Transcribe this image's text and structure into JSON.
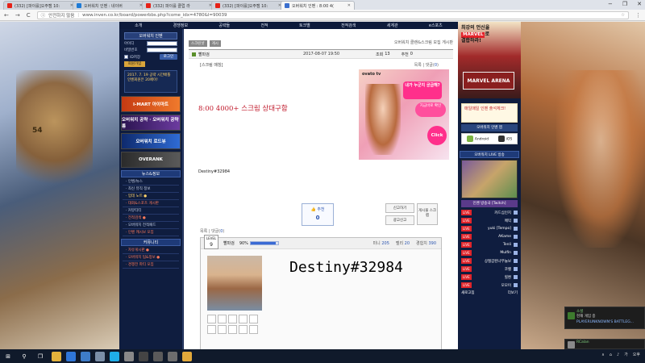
{
  "browser": {
    "tabs": [
      {
        "label": "(332) [파이를]오주캠 10:",
        "color": "#e62117",
        "active": false
      },
      {
        "label": "오버워치 인벤 : 네이버",
        "color": "#1e7bd6",
        "active": false
      },
      {
        "label": "(332) 파이를 클럽 라",
        "color": "#e62117",
        "active": false
      },
      {
        "label": "(332) [파이를]오주캠 10:",
        "color": "#e62117",
        "active": false
      },
      {
        "label": "오버워치 인벤 : 8:00 4(",
        "color": "#3b6fce",
        "active": true
      }
    ],
    "url_secure_label": "안전하지 않음",
    "url": "www.inven.co.kr/board/powerbbs.php?come_idx=4780&l=90039",
    "nav_back": "←",
    "nav_forward": "→",
    "nav_reload": "C",
    "win_min": "−",
    "win_max": "❐",
    "win_close": "✕"
  },
  "site": {
    "topnav": [
      "소개",
      "경쟁정보",
      "공략들",
      "전적",
      "토크별",
      "전적검색",
      "세계관",
      "e스포츠"
    ],
    "login": {
      "title": "오버워치 인벤",
      "id_label": "아이디",
      "pw_label": "비밀번호",
      "save_label": "ID저장",
      "login_button": "로그인",
      "join_button": "회원가입"
    },
    "event_text": "2017. 7. 19 공략 시간배틀 인벤회원은 20페이!",
    "ads": [
      {
        "label": "I-MART 아이마트",
        "style": "orange"
      },
      {
        "label": "오버워치 공략 · 오버워치 공략룸",
        "style": "purple"
      },
      {
        "label": "오버워치 로드뷰",
        "style": "blue"
      },
      {
        "label": "OVERANK",
        "style": "dark"
      }
    ],
    "news_header": "뉴스&정보",
    "news_items": [
      {
        "label": "· 인벤/뉴스",
        "cls": ""
      },
      {
        "label": "· 최신 뮤직 정보",
        "cls": ""
      },
      {
        "label": "· 업데 노트 ●",
        "cls": "yellow"
      },
      {
        "label": "· 대회&스포츠 게시판",
        "cls": "hot"
      },
      {
        "label": "· 커뮤티티",
        "cls": ""
      },
      {
        "label": "· 전적검색 ●",
        "cls": "hot"
      },
      {
        "label": "· 오버워치 전적패드",
        "cls": ""
      },
      {
        "label": "· 인벤 캐시보 모집",
        "cls": "hot"
      }
    ],
    "community_header": "커뮤니티",
    "community_items": [
      {
        "label": "· 자유게시판 ●",
        "cls": "hot"
      },
      {
        "label": "· 오버워치 팁&정보 ●",
        "cls": "hot"
      },
      {
        "label": "· 경쟁전 파티 모집",
        "cls": "hot"
      }
    ]
  },
  "post": {
    "crumb": [
      "스크린샷",
      "게시"
    ],
    "board_name": "오버워치 클랜&스크림 모집 게시판",
    "author": "빨파검",
    "date": "2017-08-07 19:50",
    "views_label": "조회",
    "views": "13",
    "rec_label": "추천",
    "rec": "0",
    "type_tag": "[스크림 매칭]",
    "list_label": "목록",
    "comment_label": "댓글",
    "comment_count": "0",
    "sep": "|",
    "headline": "8:00 4000+ 스크림 상대구함",
    "body_text": "Destiny#32984",
    "vote_label": "추천",
    "vote_count": "0",
    "report_button": "신고하기",
    "ad_report_button": "광고신고",
    "to_scrim_button": "게시물 스크랩"
  },
  "ovato_ad": {
    "brand": "ovato tv",
    "bubble_text": "내가 누군지 궁금해?",
    "bubble_sub": "지금바로 확인",
    "click_label": "Click"
  },
  "profile": {
    "level_label": "LEVEL",
    "level": "9",
    "name": "빨파검",
    "hp_percent_text": "90%",
    "hp_fraction": 0.9,
    "mini_label": "미니",
    "mini_value": "205",
    "bell_label": "벨리",
    "bell_value": "20",
    "exp_label": "경험치",
    "exp_value": "390",
    "signature": "Destiny#32984"
  },
  "rside": {
    "marvel_line1": "최강의 언신을",
    "marvel_logo": "MARVEL",
    "marvel_line2": "로",
    "marvel_line3": "결합하라!",
    "arena": "MARVEL ARENA",
    "mobile_banner": "매일매일 인벤 출석체크!",
    "app_bar": "오버워치 인벤 앱",
    "android": "Android",
    "ios": "iOS",
    "live_header": "오버워치 LIVE 방송",
    "twitch_label": "인벤 방송국 [Twitch]",
    "live_tag": "LIVE",
    "live_list": [
      "카드십인지",
      "메익",
      "yuki [Tempo]",
      "AKame",
      "Tenli",
      "Mulfin",
      "상철갑된나무늘보",
      "코렐",
      "힐켠",
      "모모이"
    ],
    "live_foot_left": "새로고침",
    "live_foot_right": "더보기"
  },
  "taskbar": {
    "start": "⊞",
    "search": "⚲",
    "task": "❐",
    "apps": [
      {
        "name": "explorer",
        "color": "#e3b23c"
      },
      {
        "name": "edge",
        "color": "#2f76d8"
      },
      {
        "name": "store",
        "color": "#3e7cc8"
      },
      {
        "name": "app1",
        "color": "#7b8fa8"
      },
      {
        "name": "skype",
        "color": "#1faee9"
      },
      {
        "name": "app2",
        "color": "#888888"
      },
      {
        "name": "obs",
        "color": "#444444"
      },
      {
        "name": "app3",
        "color": "#5a5a5a"
      },
      {
        "name": "app4",
        "color": "#6d6d6d"
      },
      {
        "name": "chrome",
        "color": "#e2a93b"
      }
    ],
    "tray": [
      "∧",
      "⌂",
      "♪",
      "가",
      "오후"
    ]
  },
  "notifications": [
    {
      "title": "소셜",
      "line1": "현재 게임 중",
      "line2": "PLAYERUNKNOWN'S BATTLEG...",
      "color": "#3d7b2e"
    },
    {
      "title": "RCalan",
      "line1": "Canadian Online",
      "line2": "2017-08-07 ...",
      "color": "#8a8a8a"
    }
  ]
}
